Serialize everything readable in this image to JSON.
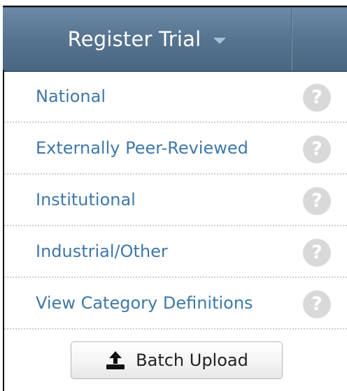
{
  "header": {
    "title": "Register Trial",
    "dropdown_icon": "chevron-down-icon"
  },
  "menu": {
    "items": [
      {
        "label": "National",
        "help_icon": "?"
      },
      {
        "label": "Externally Peer-Reviewed",
        "help_icon": "?"
      },
      {
        "label": "Institutional",
        "help_icon": "?"
      },
      {
        "label": "Industrial/Other",
        "help_icon": "?"
      },
      {
        "label": "View Category Definitions",
        "help_icon": "?"
      }
    ]
  },
  "batch_upload": {
    "label": "Batch Upload",
    "icon": "upload-icon"
  },
  "colors": {
    "header_bg": "#56748f",
    "link": "#3f78a8",
    "help_icon_bg": "#d9d9d9"
  }
}
